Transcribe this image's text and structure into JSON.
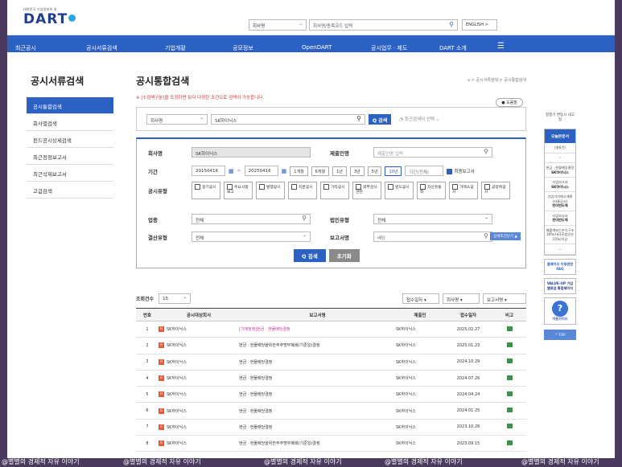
{
  "header": {
    "logo_small": "대한민국 기업정보의 창",
    "logo": "DART",
    "company_select": "회사명",
    "search_placeholder": "회사명/종목코드 입력",
    "english": "ENGLISH >"
  },
  "nav": [
    "최근공시",
    "공시서류검색",
    "기업개황",
    "공모정보",
    "OpenDART",
    "공시업무 · 제도",
    "DART 소개"
  ],
  "sidebar": {
    "title": "공시서류검색",
    "items": [
      "공시통합검색",
      "회사별검색",
      "펀드공시상세검색",
      "최근정정보고서",
      "최근삭제보고서",
      "고급검색"
    ]
  },
  "main": {
    "title": "공시통합검색",
    "breadcrumb": "⌂ > 공시서류검색 > 공시통합검색",
    "notice": "※ [↕검색구분]을 조정하면 보다 다양한 조건으로 검색이 가능합니다.",
    "help": "● 도움말",
    "search": {
      "select": "회사명",
      "value": "SK하이닉스",
      "button": "Q 검색",
      "recent": "최근검색어 선택"
    },
    "form": {
      "company_label": "회사명",
      "company_value": "SK하이닉스",
      "filer_label": "제출인명",
      "filer_placeholder": "제출인명 입력",
      "period_label": "기간",
      "date_from": "20150416",
      "date_to": "20250416",
      "periods": [
        "1개월",
        "6개월",
        "1년",
        "3년",
        "5년",
        "10년"
      ],
      "period_select": "기간(전체)",
      "final_label": "최종보고서",
      "type_label": "공시유형",
      "types": [
        "정기공시",
        "주요사항보고",
        "발행공시",
        "지분공시",
        "기타공시",
        "외부감사관련",
        "펀드공시",
        "자산유동화",
        "거래소공시",
        "공정위공시"
      ],
      "industry_label": "업종",
      "industry_value": "전체",
      "corp_type_label": "법인유형",
      "corp_type_value": "전체",
      "settle_label": "결산유형",
      "settle_value": "전체",
      "report_label": "보고서명",
      "report_placeholder": "배당",
      "detail": "상세조건닫기 ▲",
      "search_btn": "Q 검색",
      "reset_btn": "초기화"
    },
    "results": {
      "count_label": "조회건수",
      "count": "15",
      "sort1": "접수일자",
      "sort2": "회사명",
      "sort3": "보고서명",
      "headers": [
        "번호",
        "공시대상회사",
        "보고서명",
        "제출인",
        "접수일자",
        "비고"
      ],
      "rows": [
        {
          "no": "1",
          "company": "SK하이닉스",
          "report": "[기재정정]현금ㆍ현물배당결정",
          "filer": "SK하이닉스",
          "date": "2025.02.27"
        },
        {
          "no": "2",
          "company": "SK하이닉스",
          "report": "현금ㆍ현물배당을위한주주명부폐쇄(기준일)결정",
          "filer": "SK하이닉스",
          "date": "2025.01.23"
        },
        {
          "no": "3",
          "company": "SK하이닉스",
          "report": "현금ㆍ현물배당결정",
          "filer": "SK하이닉스",
          "date": "2024.10.29"
        },
        {
          "no": "4",
          "company": "SK하이닉스",
          "report": "현금ㆍ현물배당결정",
          "filer": "SK하이닉스",
          "date": "2024.07.26"
        },
        {
          "no": "5",
          "company": "SK하이닉스",
          "report": "현금ㆍ현물배당결정",
          "filer": "SK하이닉스",
          "date": "2024.04.24"
        },
        {
          "no": "6",
          "company": "SK하이닉스",
          "report": "현금ㆍ현물배당결정",
          "filer": "SK하이닉스",
          "date": "2024.01.25"
        },
        {
          "no": "7",
          "company": "SK하이닉스",
          "report": "현금ㆍ현물배당결정",
          "filer": "SK하이닉스",
          "date": "2023.10.26"
        },
        {
          "no": "8",
          "company": "SK하이닉스",
          "report": "현금ㆍ현물배당을위한주주명부폐쇄(기준일)결정",
          "filer": "SK하이닉스",
          "date": "2023.09.15"
        }
      ]
    }
  },
  "right": {
    "hint": "정정기 변동시 내고정",
    "panel_title": "오늘본문서",
    "count": "(총6건)",
    "items": [
      {
        "t": "현금ㆍ현물배당결정",
        "c": "SK하이닉스"
      },
      {
        "t": "사업보고서",
        "c": "SK하이닉스"
      },
      {
        "t": "기업가치제고계획(자율공시)",
        "c": "한미반도체"
      },
      {
        "t": "사업보고서",
        "c": "한미반도체"
      },
      {
        "t": "매출액또는손익구조30%(대규모법인은15%)이상",
        "c": ""
      }
    ],
    "box1": "홈페이지 이용관련 FAQ",
    "box2": "VALUE-UP 기업밸류업 통합페이지",
    "guide": "이용가이드",
    "top": "^ TOP"
  },
  "watermark": "@별별의 경제적 자유 이야기"
}
